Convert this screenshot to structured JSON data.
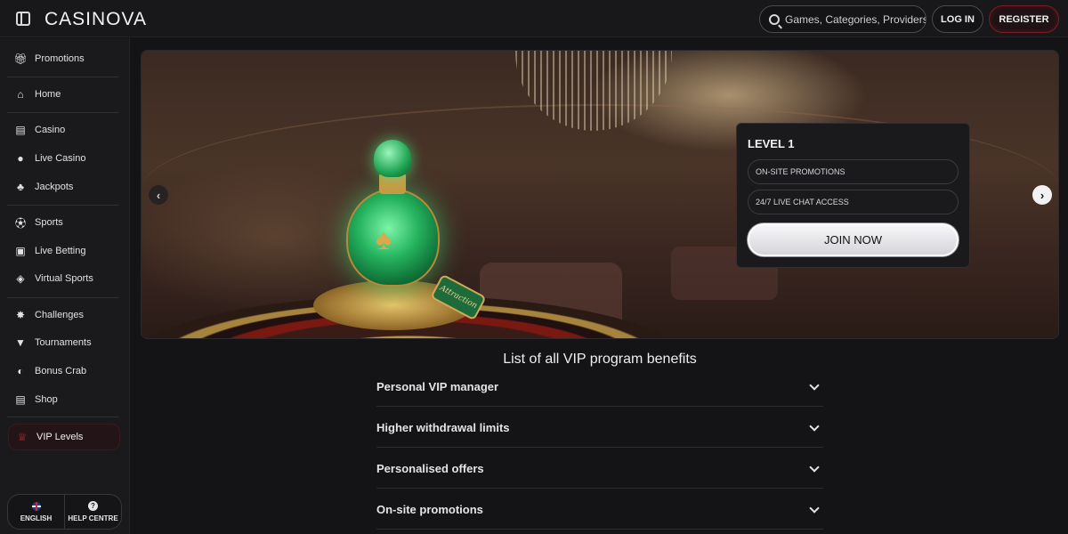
{
  "header": {
    "logo": "CASINOVA",
    "search_placeholder": "Games, Categories, Providers",
    "login_label": "LOG IN",
    "register_label": "REGISTER"
  },
  "sidebar": {
    "items": [
      {
        "label": "Promotions",
        "icon": "gift-icon"
      },
      {
        "label": "Home",
        "icon": "home-icon"
      },
      {
        "label": "Casino",
        "icon": "slot-machine-icon"
      },
      {
        "label": "Live Casino",
        "icon": "dealer-icon"
      },
      {
        "label": "Jackpots",
        "icon": "clover-icon"
      },
      {
        "label": "Sports",
        "icon": "football-icon"
      },
      {
        "label": "Live Betting",
        "icon": "live-icon"
      },
      {
        "label": "Virtual Sports",
        "icon": "virtual-icon"
      },
      {
        "label": "Challenges",
        "icon": "medal-icon"
      },
      {
        "label": "Tournaments",
        "icon": "trophy-icon"
      },
      {
        "label": "Bonus Crab",
        "icon": "crab-icon"
      },
      {
        "label": "Shop",
        "icon": "shop-icon"
      }
    ],
    "vip_label": "VIP Levels",
    "footer": {
      "language_label": "ENGLISH",
      "help_label": "HELP CENTRE"
    }
  },
  "banner": {
    "tag_text": "Attraction",
    "level_title": "LEVEL 1",
    "perks": [
      "ON-SITE PROMOTIONS",
      "24/7 LIVE CHAT ACCESS"
    ],
    "cta_label": "JOIN NOW"
  },
  "benefits": {
    "title": "List of all VIP program benefits",
    "items": [
      "Personal VIP manager",
      "Higher withdrawal limits",
      "Personalised offers",
      "On-site promotions"
    ]
  },
  "colors": {
    "background": "#141416",
    "accent_red": "#7a1e24",
    "vip_icon": "#c7303a"
  }
}
